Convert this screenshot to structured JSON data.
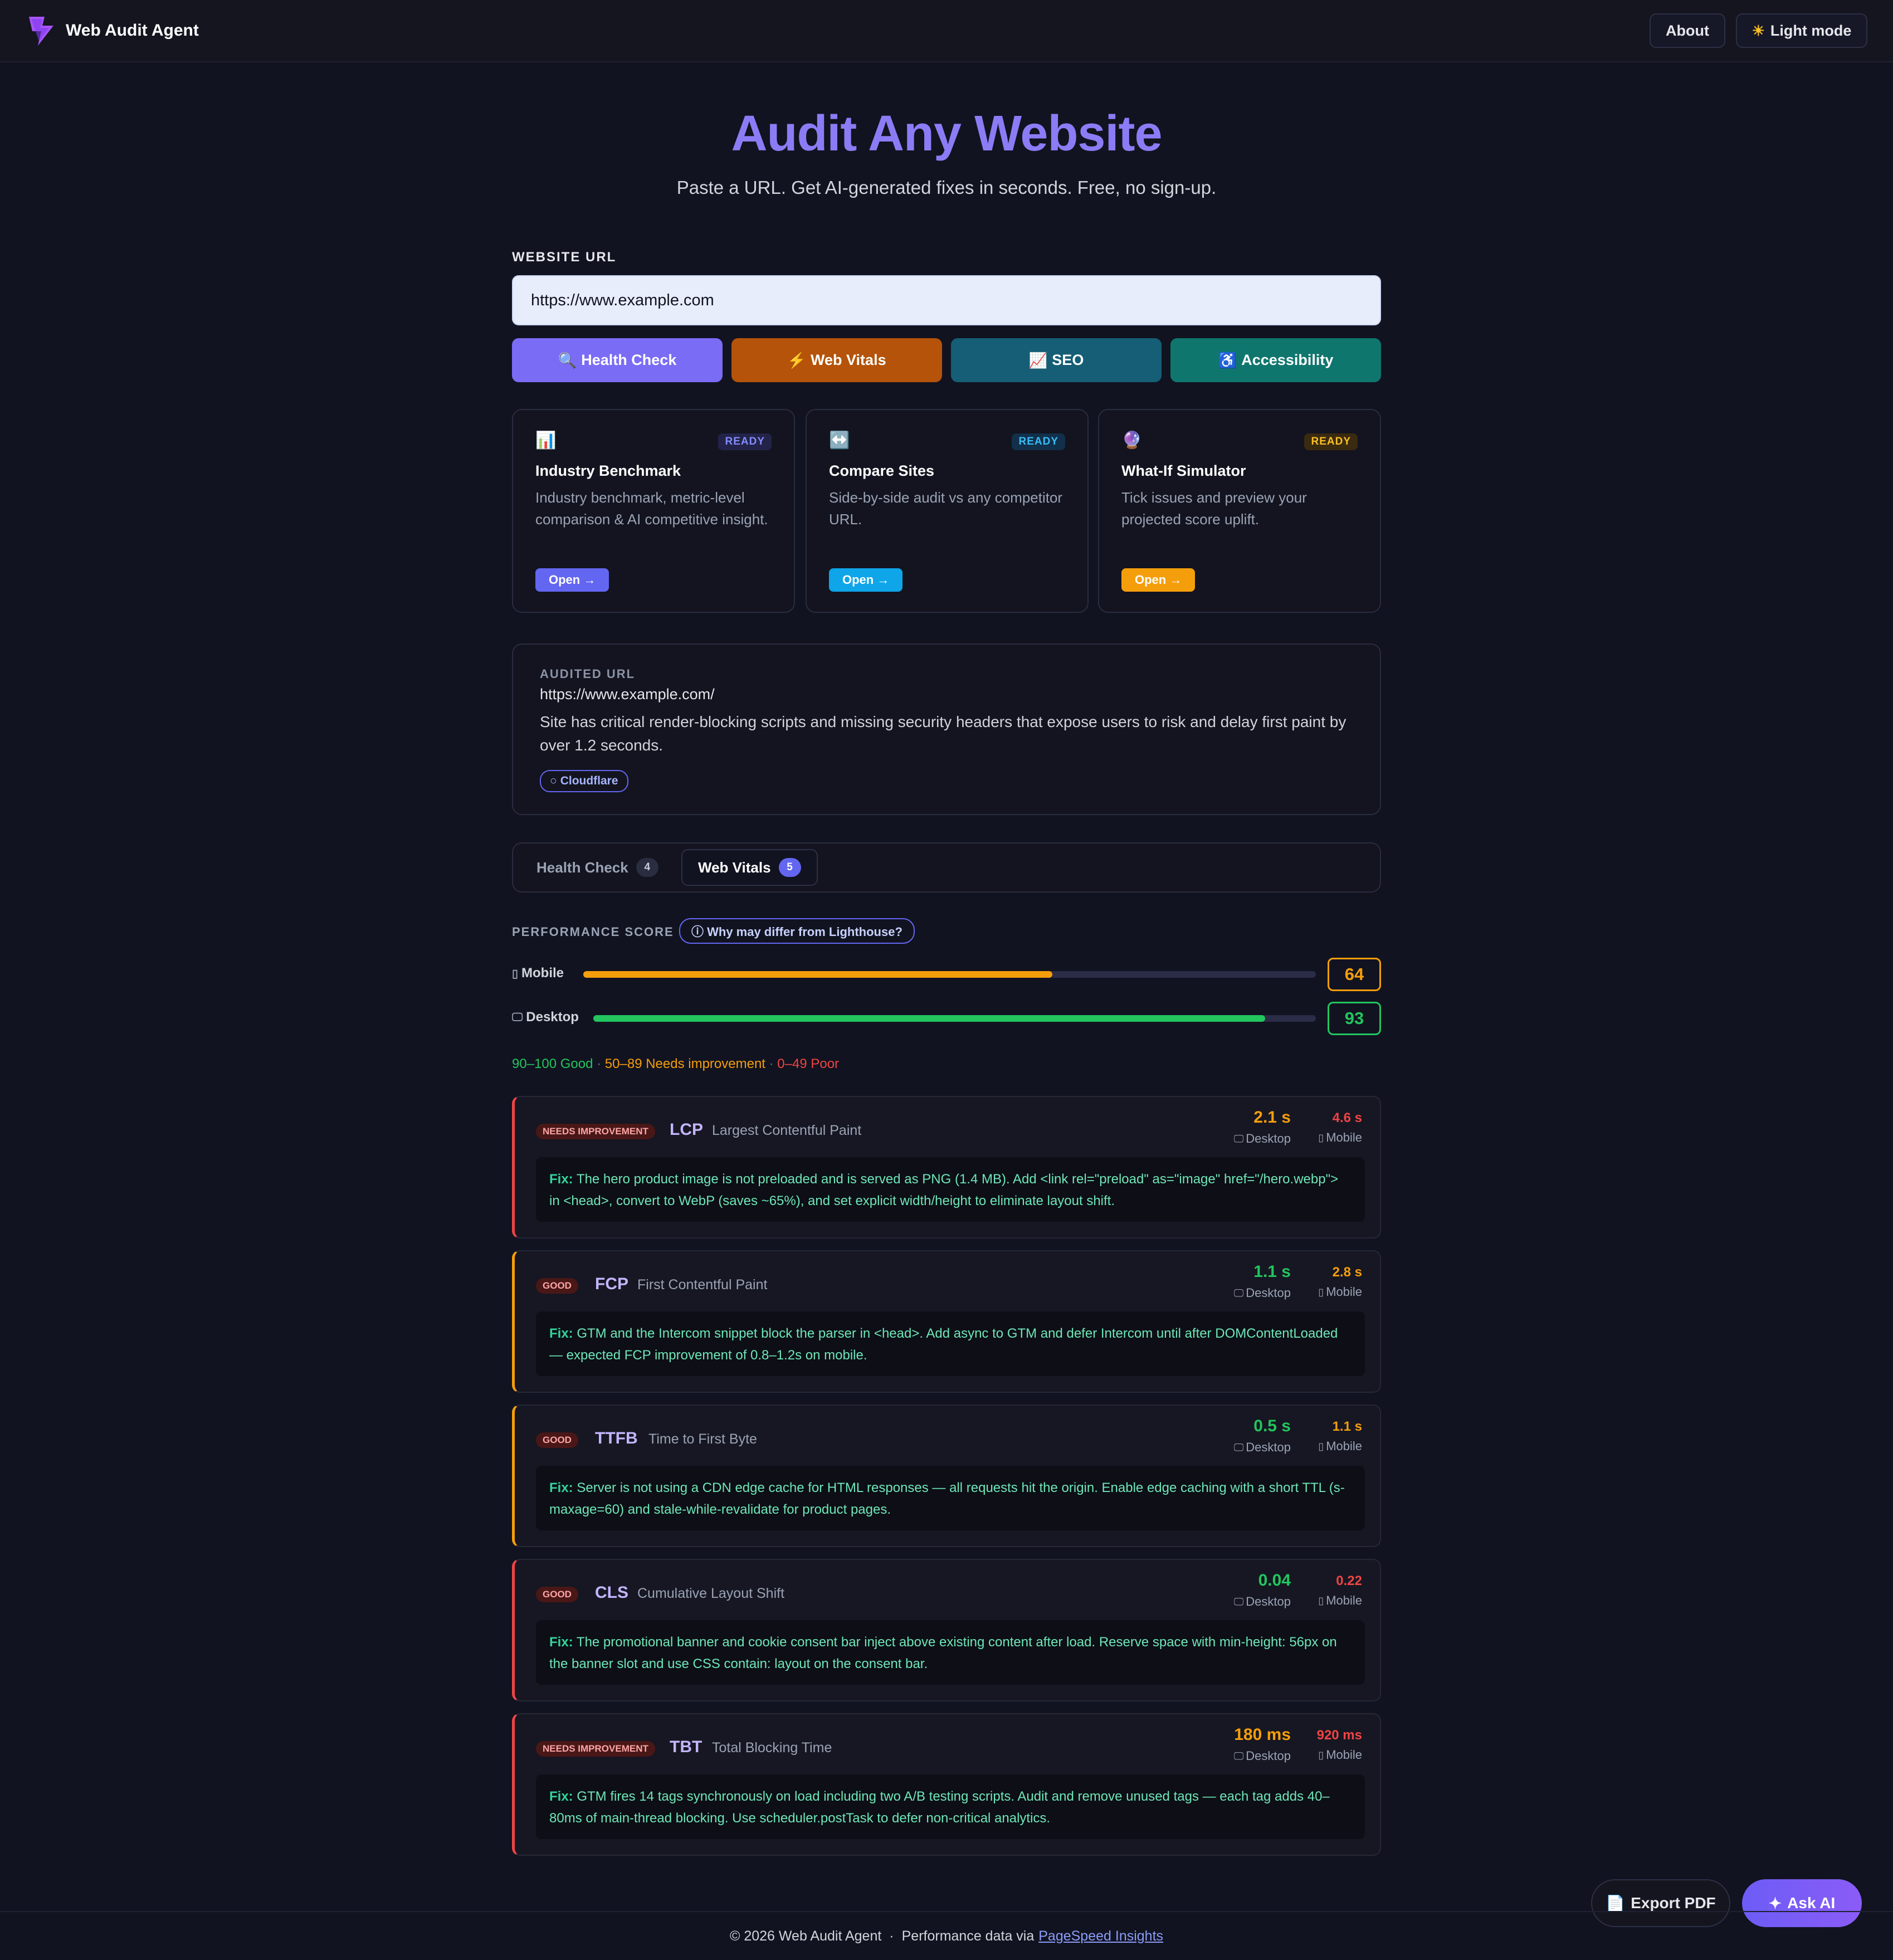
{
  "app": {
    "name": "Web Audit Agent"
  },
  "header": {
    "about_label": "About",
    "theme_label": "Light mode",
    "theme_icon": "sun-icon"
  },
  "hero": {
    "title": "Audit Any Website",
    "subtitle": "Paste a URL. Get AI-generated fixes in seconds. Free, no sign-up."
  },
  "form": {
    "url_label": "WEBSITE URL",
    "url_value": "https://www.example.com",
    "buttons": [
      {
        "label": "Health Check",
        "icon": "magnifier-icon",
        "color": "#7b6cf6"
      },
      {
        "label": "Web Vitals",
        "icon": "lightning-icon",
        "color": "#b45309"
      },
      {
        "label": "SEO",
        "icon": "chart-up-icon",
        "color": "#155e75"
      },
      {
        "label": "Accessibility",
        "icon": "accessibility-icon",
        "color": "#0f766e"
      }
    ]
  },
  "tools": [
    {
      "title": "Industry Benchmark",
      "status": "READY",
      "desc": "Industry benchmark, metric-level comparison & AI competitive insight.",
      "open_label": "Open →",
      "icon": "bar-chart-icon",
      "accent": "#6366f1"
    },
    {
      "title": "Compare Sites",
      "status": "READY",
      "desc": "Side-by-side audit vs any competitor URL.",
      "open_label": "Open →",
      "icon": "left-right-arrow-icon",
      "accent": "#0ea5e9"
    },
    {
      "title": "What-If Simulator",
      "status": "READY",
      "desc": "Tick issues and preview your projected score uplift.",
      "open_label": "Open →",
      "icon": "crystal-ball-icon",
      "accent": "#f59e0b"
    }
  ],
  "audit": {
    "label": "AUDITED URL",
    "url": "https://www.example.com/",
    "summary": "Site has critical render-blocking scripts and missing security headers that expose users to risk and delay first paint by over 1.2 seconds.",
    "tag": "Cloudflare"
  },
  "tabs": [
    {
      "label": "Health Check",
      "count": "4",
      "active": false
    },
    {
      "label": "Web Vitals",
      "count": "5",
      "active": true
    }
  ],
  "performance": {
    "label": "PERFORMANCE SCORE",
    "info_label": "ⓘ Why may differ from Lighthouse?",
    "rows": [
      {
        "device": "Mobile",
        "score": 64,
        "color": "#f59e0b"
      },
      {
        "device": "Desktop",
        "score": 93,
        "color": "#22c55e"
      }
    ],
    "legend": {
      "good": "90–100 Good",
      "sep1": " · ",
      "mid": "50–89 Needs improvement",
      "sep2": " · ",
      "poor": "0–49 Poor"
    }
  },
  "metrics": [
    {
      "badge": "NEEDS IMPROVEMENT",
      "abbr": "LCP",
      "name": "Largest Contentful Paint",
      "desktop": "2.1 s",
      "mobile": "4.6 s",
      "desktop_color": "#f59e0b",
      "mobile_color": "#ef4444",
      "border": "#ef4444",
      "desktop_label": "Desktop",
      "mobile_label": "Mobile",
      "fix_label": "Fix:",
      "fix": " The hero product image is not preloaded and is served as PNG (1.4 MB). Add <link rel=\"preload\" as=\"image\" href=\"/hero.webp\"> in <head>, convert to WebP (saves ~65%), and set explicit width/height to eliminate layout shift."
    },
    {
      "badge": "GOOD",
      "abbr": "FCP",
      "name": "First Contentful Paint",
      "desktop": "1.1 s",
      "mobile": "2.8 s",
      "desktop_color": "#22c55e",
      "mobile_color": "#f59e0b",
      "border": "#f59e0b",
      "desktop_label": "Desktop",
      "mobile_label": "Mobile",
      "fix_label": "Fix:",
      "fix": " GTM and the Intercom snippet block the parser in <head>. Add async to GTM and defer Intercom until after DOMContentLoaded — expected FCP improvement of 0.8–1.2s on mobile."
    },
    {
      "badge": "GOOD",
      "abbr": "TTFB",
      "name": "Time to First Byte",
      "desktop": "0.5 s",
      "mobile": "1.1 s",
      "desktop_color": "#22c55e",
      "mobile_color": "#f59e0b",
      "border": "#f59e0b",
      "desktop_label": "Desktop",
      "mobile_label": "Mobile",
      "fix_label": "Fix:",
      "fix": " Server is not using a CDN edge cache for HTML responses — all requests hit the origin. Enable edge caching with a short TTL (s-maxage=60) and stale-while-revalidate for product pages."
    },
    {
      "badge": "GOOD",
      "abbr": "CLS",
      "name": "Cumulative Layout Shift",
      "desktop": "0.04",
      "mobile": "0.22",
      "desktop_color": "#22c55e",
      "mobile_color": "#ef4444",
      "border": "#ef4444",
      "desktop_label": "Desktop",
      "mobile_label": "Mobile",
      "fix_label": "Fix:",
      "fix": " The promotional banner and cookie consent bar inject above existing content after load. Reserve space with min-height: 56px on the banner slot and use CSS contain: layout on the consent bar."
    },
    {
      "badge": "NEEDS IMPROVEMENT",
      "abbr": "TBT",
      "name": "Total Blocking Time",
      "desktop": "180 ms",
      "mobile": "920 ms",
      "desktop_color": "#f59e0b",
      "mobile_color": "#ef4444",
      "border": "#ef4444",
      "desktop_label": "Desktop",
      "mobile_label": "Mobile",
      "fix_label": "Fix:",
      "fix": " GTM fires 14 tags synchronously on load including two A/B testing scripts. Audit and remove unused tags — each tag adds 40–80ms of main-thread blocking. Use scheduler.postTask to defer non-critical analytics."
    }
  ],
  "actions": {
    "export_label": "Export PDF",
    "ask_label": "Ask AI"
  },
  "footer": {
    "copyright": "© 2026 Web Audit Agent",
    "sep": "·",
    "via": "Performance data via",
    "link": "PageSpeed Insights"
  }
}
